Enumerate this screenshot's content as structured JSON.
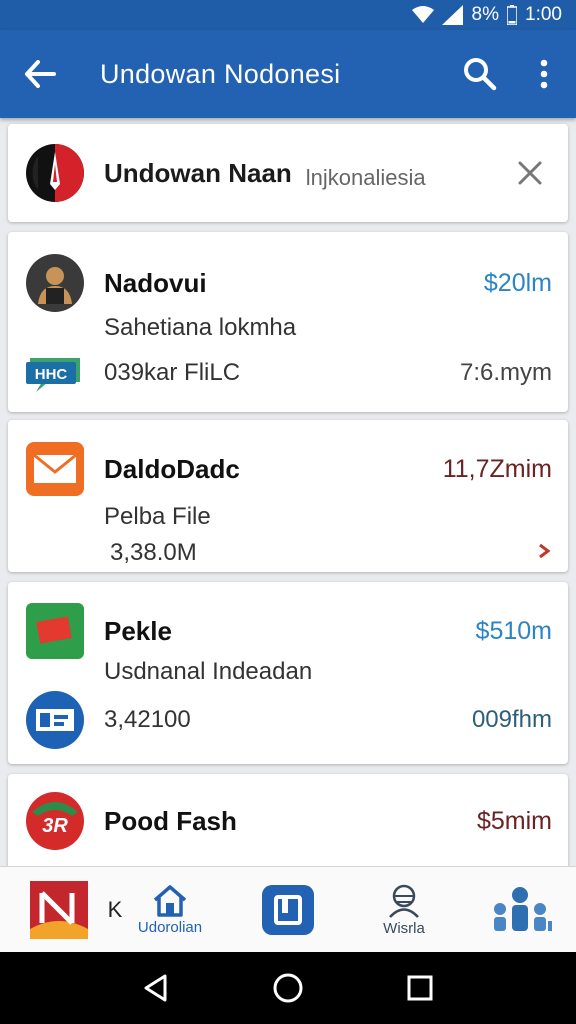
{
  "status_bar": {
    "battery": "8%",
    "time": "1:00"
  },
  "app_bar": {
    "title": "Undowan Nodonesi",
    "icons": [
      "arrow-back-icon",
      "search-icon",
      "more-vert-icon"
    ]
  },
  "search_card": {
    "title": "Undowan Naan",
    "subtitle": "lnjkonaliesia"
  },
  "items": [
    {
      "name": "Nadovui",
      "subtitle": "Sahetiana lokmha",
      "badge": "HHC",
      "meta": "039kar  FliLC",
      "price": "$20lm",
      "time": "7:6.mym"
    },
    {
      "name": "DaldoDadc",
      "subtitle": "Pelba File",
      "meta": "3,38.0M",
      "price": "11,7Zmim"
    },
    {
      "name": "Pekle",
      "subtitle": "Usdnanal Indeadan",
      "meta": "3,42100",
      "price": "$510m",
      "time": "009fhm"
    },
    {
      "name": "Pood Fash",
      "price": "$5mim"
    }
  ],
  "bottom_nav": {
    "profile_label": "K",
    "home_label": "Udorolian",
    "center_label": "",
    "misc_label": "Wisrla"
  },
  "colors": {
    "primary": "#2361b2",
    "status_bar": "#1f5da9",
    "accent_blue": "#2b84c8",
    "accent_dark_red": "#6b2222"
  }
}
